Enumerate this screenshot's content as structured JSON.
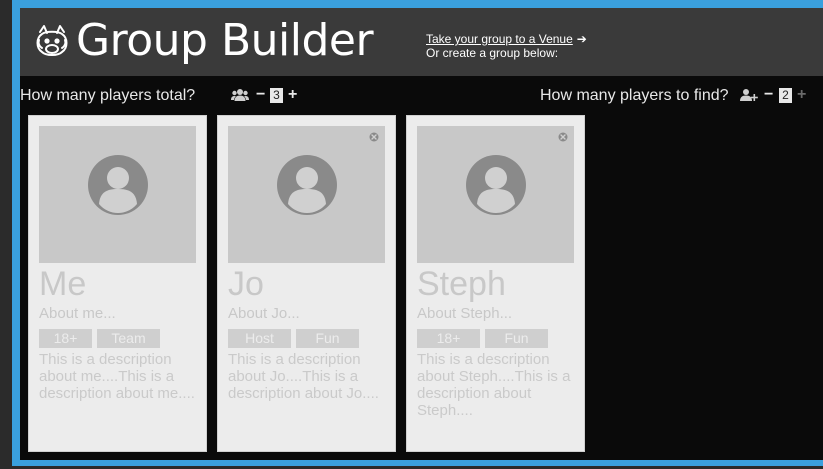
{
  "header": {
    "title": "Group Builder",
    "logo_icon": "boar-icon",
    "venue_link": "Take your group to a Venue",
    "venue_arrow": "➔",
    "create_text": "Or create a group below:"
  },
  "controls": {
    "total_label": "How many players total?",
    "total_icon": "users-icon",
    "total_minus": "−",
    "total_value": "3",
    "total_plus": "+",
    "find_label": "How many players to find?",
    "find_icon": "user-plus-icon",
    "find_minus": "−",
    "find_value": "2",
    "find_plus": "+"
  },
  "cards": [
    {
      "name": "Me",
      "about": "About me...",
      "tags": [
        "18+",
        "Team"
      ],
      "description": "This is a description about me....This is a description about me....",
      "removable": false
    },
    {
      "name": "Jo",
      "about": "About Jo...",
      "tags": [
        "Host",
        "Fun"
      ],
      "description": "This is a description about Jo....This is a description about Jo....",
      "removable": true
    },
    {
      "name": "Steph",
      "about": "About Steph...",
      "tags": [
        "18+",
        "Fun"
      ],
      "description": "This is a description about Steph....This is a description about Steph....",
      "removable": true
    }
  ],
  "colors": {
    "frame": "#3aa0de",
    "header_bg": "#3a3a3a",
    "card_bg": "#ececec"
  }
}
